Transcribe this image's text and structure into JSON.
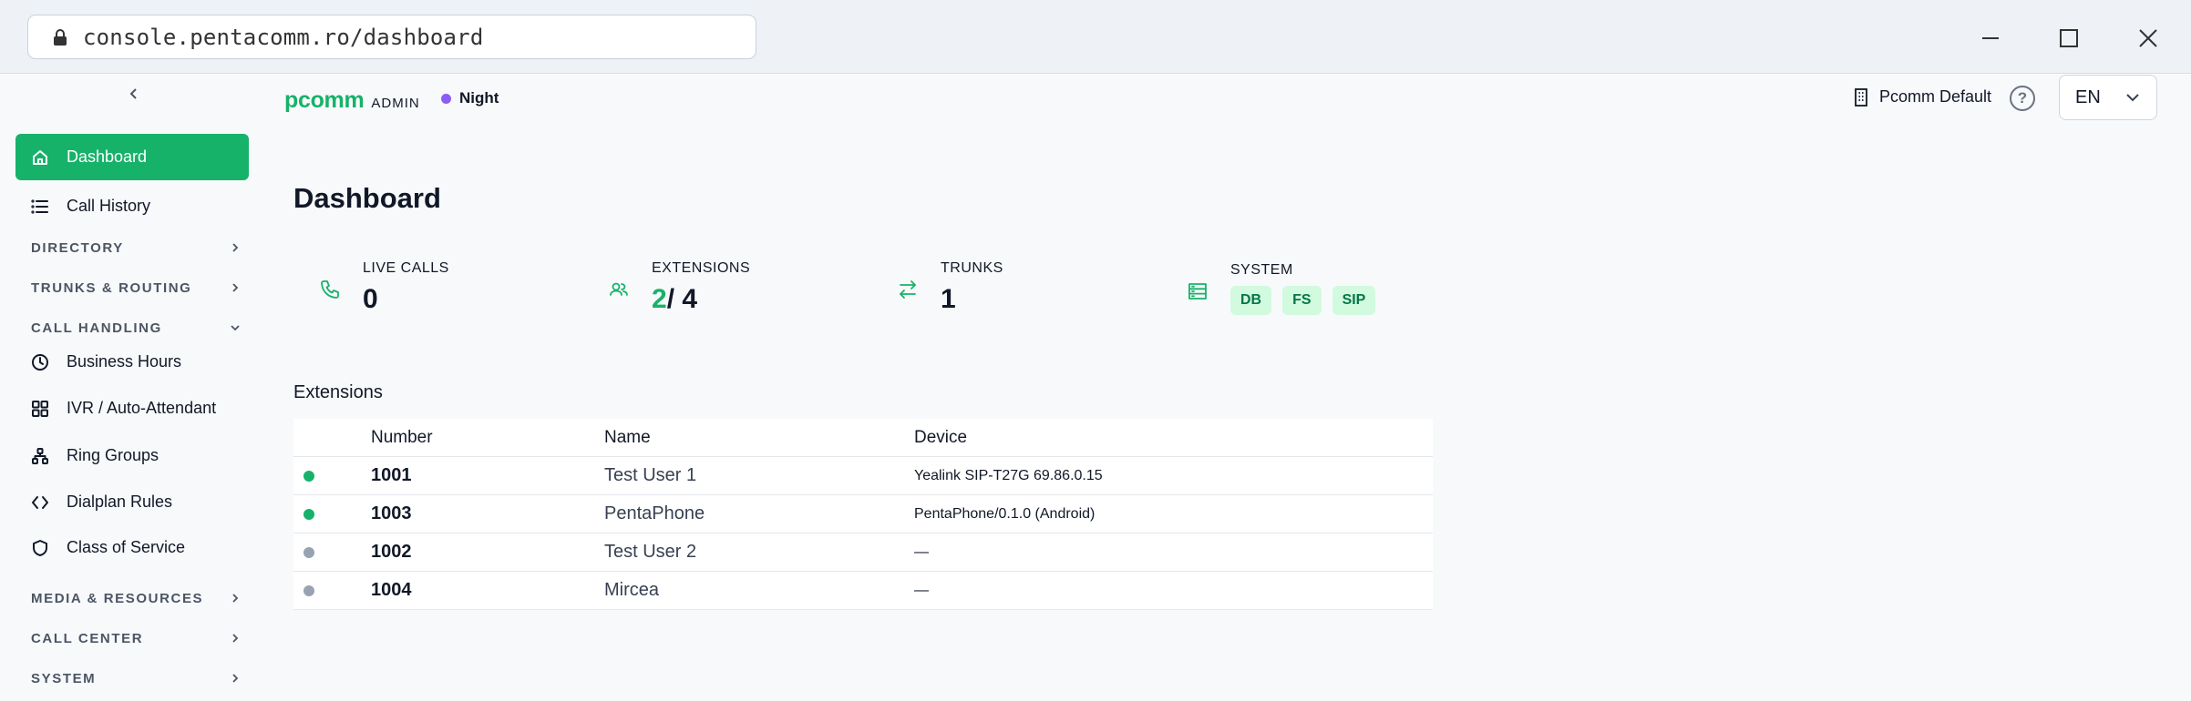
{
  "browser": {
    "url": "console.pentacomm.ro/dashboard"
  },
  "brand": {
    "name": "pcomm",
    "suffix": "ADMIN"
  },
  "mode": {
    "label": "Night",
    "color": "#8b5cf6"
  },
  "header": {
    "tenant": "Pcomm Default",
    "help": "?",
    "language": "EN"
  },
  "sidebar": {
    "items": [
      {
        "label": "Dashboard",
        "icon": "home-icon",
        "active": true
      },
      {
        "label": "Call History",
        "icon": "list-icon"
      },
      {
        "label": "Business Hours",
        "icon": "clock-icon"
      },
      {
        "label": "IVR / Auto-Attendant",
        "icon": "grid-icon"
      },
      {
        "label": "Ring Groups",
        "icon": "network-icon"
      },
      {
        "label": "Dialplan Rules",
        "icon": "code-icon"
      },
      {
        "label": "Class of Service",
        "icon": "shield-icon"
      }
    ],
    "sections": [
      {
        "label": "DIRECTORY",
        "expanded": false
      },
      {
        "label": "TRUNKS & ROUTING",
        "expanded": false
      },
      {
        "label": "CALL HANDLING",
        "expanded": true
      },
      {
        "label": "MEDIA & RESOURCES",
        "expanded": false
      },
      {
        "label": "CALL CENTER",
        "expanded": false
      },
      {
        "label": "SYSTEM",
        "expanded": false
      }
    ]
  },
  "main": {
    "title": "Dashboard",
    "stats": {
      "live_calls": {
        "label": "LIVE CALLS",
        "value": "0"
      },
      "extensions": {
        "label": "EXTENSIONS",
        "online": "2",
        "total": "/ 4"
      },
      "trunks": {
        "label": "TRUNKS",
        "value": "1"
      },
      "system": {
        "label": "SYSTEM",
        "badges": [
          "DB",
          "FS",
          "SIP"
        ]
      }
    },
    "extensions": {
      "heading": "Extensions",
      "columns": [
        "Number",
        "Name",
        "Device"
      ],
      "rows": [
        {
          "number": "1001",
          "name": "Test User 1",
          "device": "Yealink SIP-T27G 69.86.0.15",
          "online": true
        },
        {
          "number": "1003",
          "name": "PentaPhone",
          "device": "PentaPhone/0.1.0 (Android)",
          "online": true
        },
        {
          "number": "1002",
          "name": "Test User 2",
          "device": "—",
          "online": false
        },
        {
          "number": "1004",
          "name": "Mircea",
          "device": "—",
          "online": false
        }
      ]
    }
  },
  "colors": {
    "accent": "#17b26a",
    "online": "#17b26a",
    "offline": "#98a2b3"
  }
}
